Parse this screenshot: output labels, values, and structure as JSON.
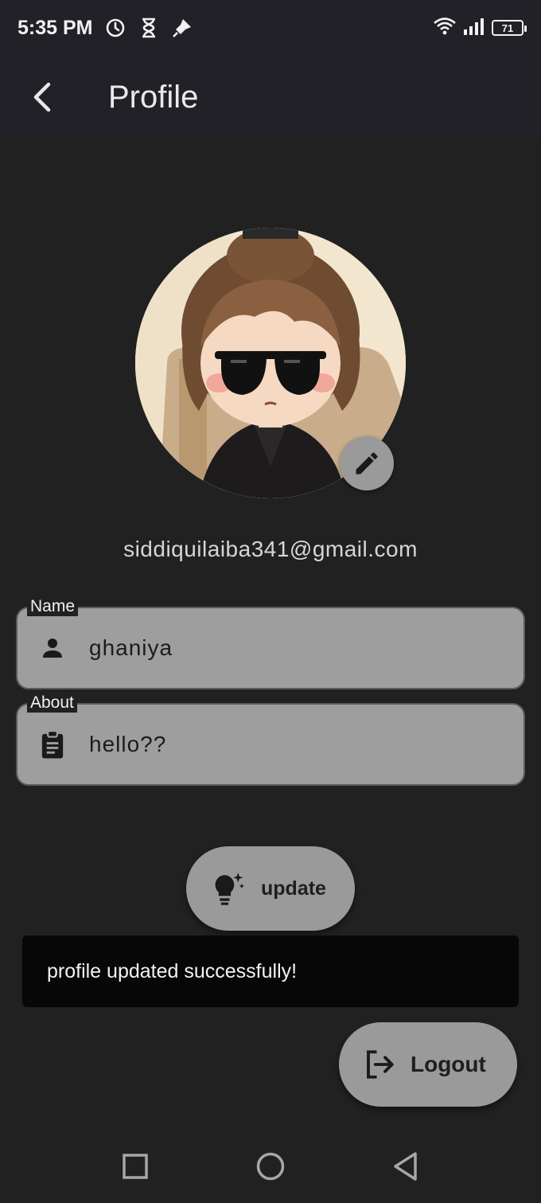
{
  "status_bar": {
    "time": "5:35 PM",
    "icons": [
      "alarm-icon",
      "hourglass-icon",
      "pin-icon"
    ],
    "right_icons": [
      "wifi-icon",
      "signal-icon"
    ],
    "battery": "71"
  },
  "app_bar": {
    "back_icon": "chevron-left-icon",
    "title": "Profile"
  },
  "profile": {
    "email": "siddiquilaiba341@gmail.com",
    "edit_icon": "pencil-icon"
  },
  "fields": {
    "name": {
      "label": "Name",
      "value": "ghaniya",
      "icon": "person-icon"
    },
    "about": {
      "label": "About",
      "value": "hello??",
      "icon": "clipboard-icon"
    }
  },
  "actions": {
    "update_label": "update",
    "update_icon": "lightbulb-sparkle-icon",
    "logout_label": "Logout",
    "logout_icon": "logout-icon"
  },
  "snackbar": {
    "text": "profile updated successfully!"
  },
  "nav_bar": {
    "buttons": [
      "recents-icon",
      "home-icon",
      "back-triangle-icon"
    ]
  },
  "colors": {
    "background": "#212121",
    "app_bar": "#222127",
    "button": "#9a9a9a",
    "field": "#9e9e9e",
    "snackbar": "#070707"
  }
}
